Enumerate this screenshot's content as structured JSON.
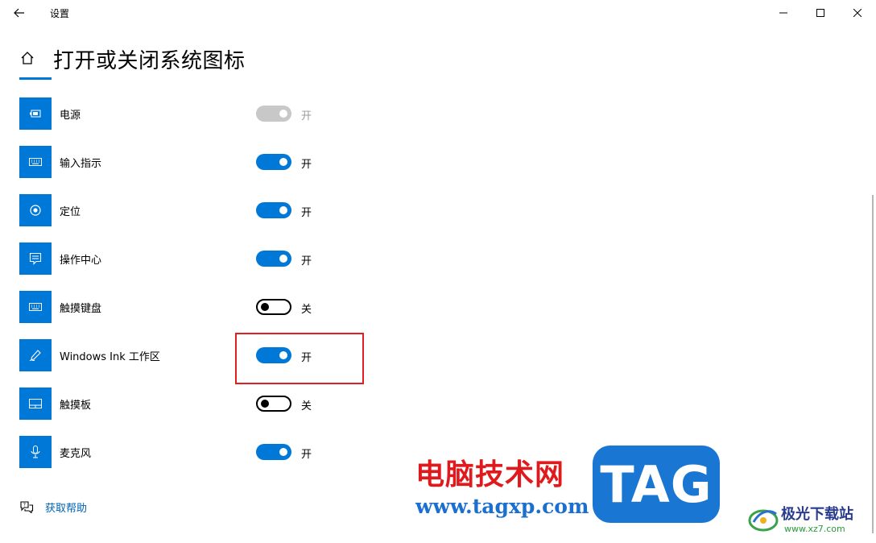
{
  "window": {
    "title": "设置"
  },
  "header": {
    "title": "打开或关闭系统图标"
  },
  "items": [
    {
      "label": "电源",
      "icon": "battery-icon",
      "state": "开",
      "toggle": "disabled"
    },
    {
      "label": "输入指示",
      "icon": "keyboard-icon",
      "state": "开",
      "toggle": "on"
    },
    {
      "label": "定位",
      "icon": "location-icon",
      "state": "开",
      "toggle": "on"
    },
    {
      "label": "操作中心",
      "icon": "action-center-icon",
      "state": "开",
      "toggle": "on"
    },
    {
      "label": "触摸键盘",
      "icon": "keyboard-icon",
      "state": "关",
      "toggle": "off"
    },
    {
      "label": "Windows Ink 工作区",
      "icon": "pen-icon",
      "state": "开",
      "toggle": "on"
    },
    {
      "label": "触摸板",
      "icon": "touchpad-icon",
      "state": "关",
      "toggle": "off"
    },
    {
      "label": "麦克风",
      "icon": "microphone-icon",
      "state": "开",
      "toggle": "on"
    }
  ],
  "help": {
    "label": "获取帮助"
  },
  "watermark": {
    "cn": "电脑技术网",
    "url": "www.tagxp.com",
    "tag": "TAG",
    "site_cn": "极光下载站",
    "site_url": "www.xz7.com"
  },
  "colors": {
    "accent": "#0078d7",
    "highlight": "#e02020",
    "link": "#0063b1"
  }
}
